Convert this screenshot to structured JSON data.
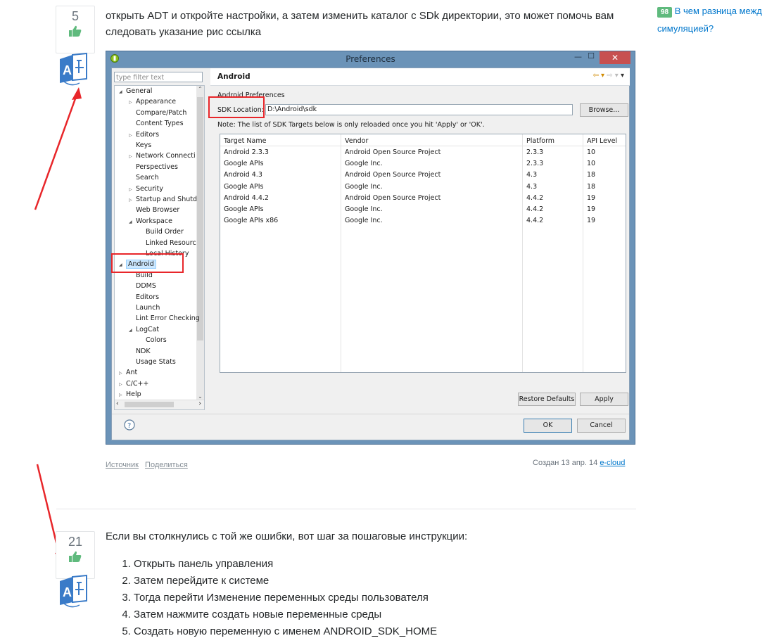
{
  "answer1": {
    "votes": "5",
    "text": "открыть ADT и откройте настройки, а затем изменить каталог с SDk директории, это может помочь вам следовать указание рис ссылка",
    "source_link": "Источник",
    "share_link": "Поделиться",
    "created_label": "Создан 13 апр. 14",
    "author": "e-cloud"
  },
  "sidebar": {
    "badge": "98",
    "question_link": "В чем разница межд симуляцией?"
  },
  "prefs": {
    "window_title": "Preferences",
    "filter_placeholder": "type filter text",
    "tree": [
      {
        "label": "General",
        "exp": "◢",
        "indent": 0
      },
      {
        "label": "Appearance",
        "exp": "▷",
        "indent": 1
      },
      {
        "label": "Compare/Patch",
        "exp": "",
        "indent": 1
      },
      {
        "label": "Content Types",
        "exp": "",
        "indent": 1
      },
      {
        "label": "Editors",
        "exp": "▷",
        "indent": 1
      },
      {
        "label": "Keys",
        "exp": "",
        "indent": 1
      },
      {
        "label": "Network Connecti",
        "exp": "▷",
        "indent": 1
      },
      {
        "label": "Perspectives",
        "exp": "",
        "indent": 1
      },
      {
        "label": "Search",
        "exp": "",
        "indent": 1
      },
      {
        "label": "Security",
        "exp": "▷",
        "indent": 1
      },
      {
        "label": "Startup and Shutd",
        "exp": "▷",
        "indent": 1
      },
      {
        "label": "Web Browser",
        "exp": "",
        "indent": 1
      },
      {
        "label": "Workspace",
        "exp": "◢",
        "indent": 1
      },
      {
        "label": "Build Order",
        "exp": "",
        "indent": 2
      },
      {
        "label": "Linked Resourc",
        "exp": "",
        "indent": 2
      },
      {
        "label": "Local History",
        "exp": "",
        "indent": 2
      },
      {
        "label": "Android",
        "exp": "◢",
        "indent": 0
      },
      {
        "label": "Build",
        "exp": "",
        "indent": 1
      },
      {
        "label": "DDMS",
        "exp": "",
        "indent": 1
      },
      {
        "label": "Editors",
        "exp": "",
        "indent": 1
      },
      {
        "label": "Launch",
        "exp": "",
        "indent": 1
      },
      {
        "label": "Lint Error Checking",
        "exp": "",
        "indent": 1
      },
      {
        "label": "LogCat",
        "exp": "◢",
        "indent": 1
      },
      {
        "label": "Colors",
        "exp": "",
        "indent": 2
      },
      {
        "label": "NDK",
        "exp": "",
        "indent": 1
      },
      {
        "label": "Usage Stats",
        "exp": "",
        "indent": 1
      },
      {
        "label": "Ant",
        "exp": "▷",
        "indent": 0
      },
      {
        "label": "C/C++",
        "exp": "▷",
        "indent": 0
      },
      {
        "label": "Help",
        "exp": "▷",
        "indent": 0
      }
    ],
    "page_title": "Android",
    "group_label": "Android Preferences",
    "sdk_label": "SDK Location:",
    "sdk_value": "D:\\Android\\sdk",
    "browse": "Browse...",
    "note": "Note: The list of SDK Targets below is only reloaded once you hit 'Apply' or 'OK'.",
    "columns": [
      "Target Name",
      "Vendor",
      "Platform",
      "API Level"
    ],
    "rows": [
      [
        "Android 2.3.3",
        "Android Open Source Project",
        "2.3.3",
        "10"
      ],
      [
        "Google APIs",
        "Google Inc.",
        "2.3.3",
        "10"
      ],
      [
        "Android 4.3",
        "Android Open Source Project",
        "4.3",
        "18"
      ],
      [
        "Google APIs",
        "Google Inc.",
        "4.3",
        "18"
      ],
      [
        "Android 4.4.2",
        "Android Open Source Project",
        "4.4.2",
        "19"
      ],
      [
        "Google APIs",
        "Google Inc.",
        "4.4.2",
        "19"
      ],
      [
        "Google APIs x86",
        "Google Inc.",
        "4.4.2",
        "19"
      ]
    ],
    "restore_defaults": "Restore Defaults",
    "apply": "Apply",
    "ok": "OK",
    "cancel": "Cancel"
  },
  "answer2": {
    "votes": "21",
    "intro": "Если вы столкнулись с той же ошибки, вот шаг за пошаговые инструкции:",
    "steps": [
      "Открыть панель управления",
      "Затем перейдите к системе",
      "Тогда перейти Изменение переменных среды пользователя",
      "Затем нажмите создать новые переменные среды",
      "Создать новую переменную с именем ANDROID_SDK_HOME"
    ]
  },
  "colors": {
    "link": "#0077cc",
    "badge": "#5fba7d",
    "annotation_red": "#e8262a",
    "window_frame": "#6b93b8"
  }
}
